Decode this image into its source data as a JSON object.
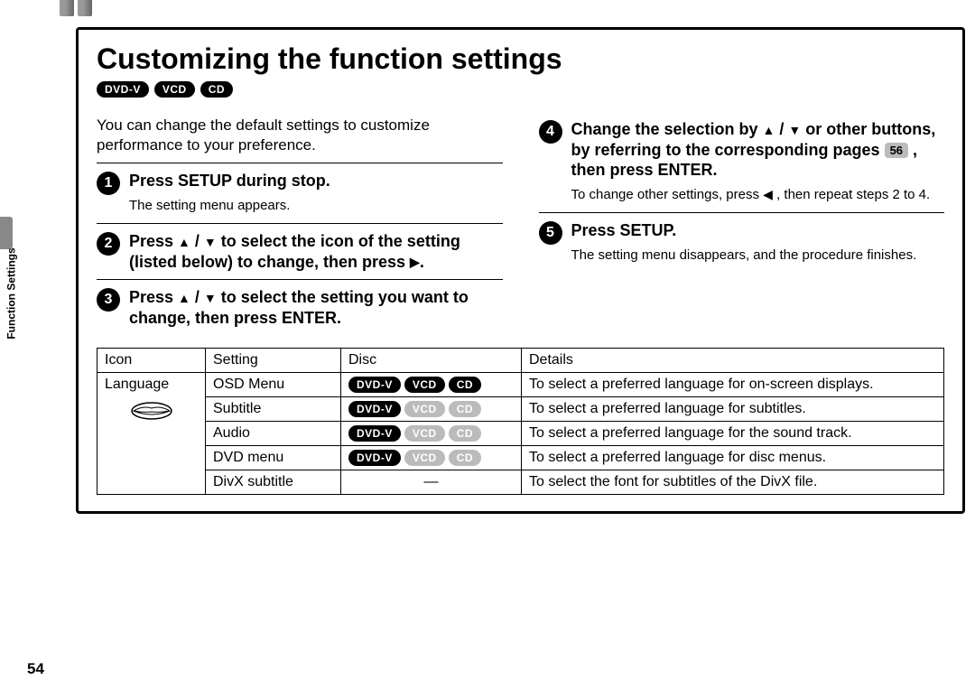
{
  "side_label": "Function Settings",
  "page_number": "54",
  "title": "Customizing the function settings",
  "title_badges": [
    "DVD-V",
    "VCD",
    "CD"
  ],
  "intro": "You can change the default settings to customize performance to your preference.",
  "steps": {
    "s1": {
      "num": "1",
      "head": "Press SETUP during stop.",
      "sub": "The setting menu appears."
    },
    "s2": {
      "num": "2",
      "head_a": "Press ",
      "head_b": " / ",
      "head_c": " to select the icon of the setting (listed below) to change, then press ",
      "head_d": "."
    },
    "s3": {
      "num": "3",
      "head_a": "Press ",
      "head_b": " / ",
      "head_c": " to select the setting you want to change, then press ENTER."
    },
    "s4": {
      "num": "4",
      "head_a": "Change the selection by ",
      "head_b": " / ",
      "head_c": " or other buttons, by referring to the corresponding pages ",
      "pref": "56",
      "head_d": " , then press ENTER.",
      "sub_a": "To change other settings, press ",
      "sub_b": " , then repeat steps 2 to 4."
    },
    "s5": {
      "num": "5",
      "head": "Press SETUP.",
      "sub": "The setting menu disappears, and the procedure finishes."
    }
  },
  "table": {
    "headers": {
      "icon": "Icon",
      "setting": "Setting",
      "disc": "Disc",
      "details": "Details"
    },
    "rows": [
      {
        "icon_label": "Language",
        "setting": "OSD Menu",
        "disc": [
          {
            "label": "DVD-V",
            "active": true
          },
          {
            "label": "VCD",
            "active": true
          },
          {
            "label": "CD",
            "active": true
          }
        ],
        "details": "To select a preferred language for on-screen displays."
      },
      {
        "setting": "Subtitle",
        "disc": [
          {
            "label": "DVD-V",
            "active": true
          },
          {
            "label": "VCD",
            "active": false
          },
          {
            "label": "CD",
            "active": false
          }
        ],
        "details": "To select a preferred language for subtitles."
      },
      {
        "setting": "Audio",
        "disc": [
          {
            "label": "DVD-V",
            "active": true
          },
          {
            "label": "VCD",
            "active": false
          },
          {
            "label": "CD",
            "active": false
          }
        ],
        "details": "To select a preferred language for the sound track."
      },
      {
        "setting": "DVD menu",
        "disc": [
          {
            "label": "DVD-V",
            "active": true
          },
          {
            "label": "VCD",
            "active": false
          },
          {
            "label": "CD",
            "active": false
          }
        ],
        "details": "To select a preferred language for disc menus."
      },
      {
        "setting": "DivX subtitle",
        "disc_dash": "—",
        "details": "To select the font for subtitles of the DivX file."
      }
    ]
  }
}
